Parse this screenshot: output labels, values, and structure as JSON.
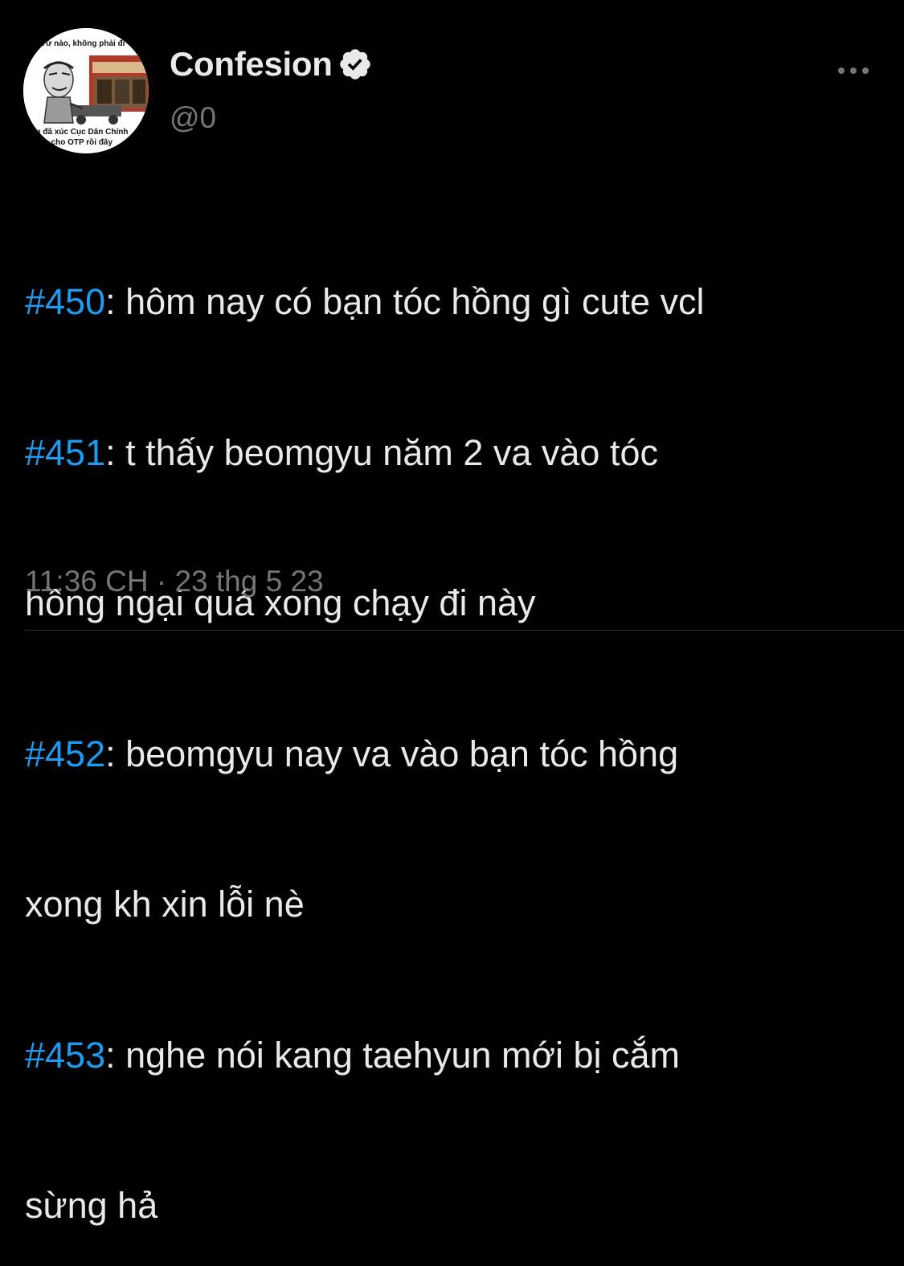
{
  "author": {
    "display_name": "Confesion",
    "handle": "@0",
    "verified": true,
    "avatar_caption_top": "Từ nào, không phải đi",
    "avatar_caption_line1": "Em đã xúc Cục Dân Chính",
    "avatar_caption_line2": "đến cho OTP rồi đây"
  },
  "more_icon": "more-horizontal-icon",
  "tweet": {
    "lines": [
      {
        "tag": "#450",
        "text": ": hôm nay có bạn tóc hồng gì cute vcl"
      },
      {
        "tag": "#451",
        "text": ": t thấy beomgyu năm 2 va vào tóc"
      },
      {
        "tag": "",
        "text": "hồng ngại quá xong chạy đi này"
      },
      {
        "tag": "#452",
        "text": ": beomgyu nay va vào bạn tóc hồng"
      },
      {
        "tag": "",
        "text": "xong kh xin lỗi nè"
      },
      {
        "tag": "#453",
        "text": ": nghe nói kang taehyun mới bị cắm"
      },
      {
        "tag": "",
        "text": "sừng hả"
      }
    ]
  },
  "timestamp": "11:36 CH · 23 thg 5 23",
  "colors": {
    "background": "#000000",
    "text": "#e7e9ea",
    "secondary": "#71767b",
    "hashtag": "#1d9bf0"
  }
}
